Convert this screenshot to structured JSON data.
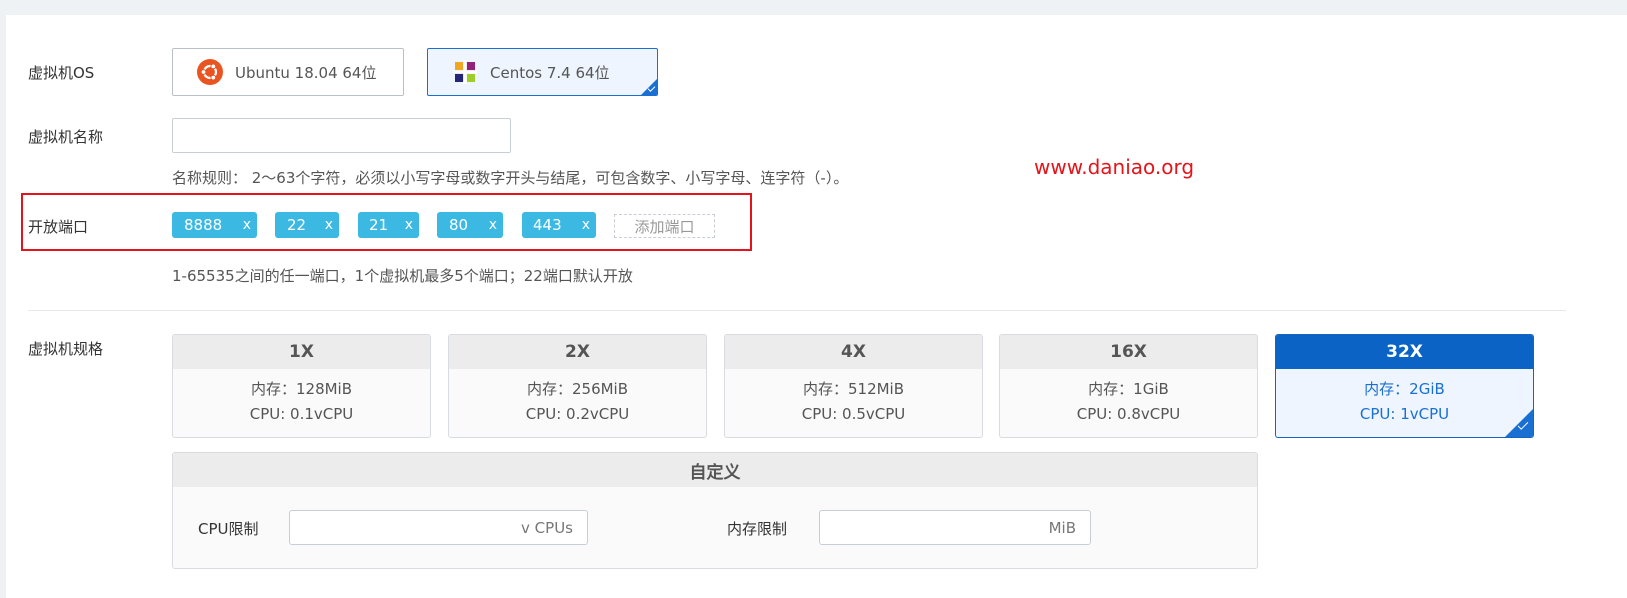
{
  "form": {
    "os": {
      "label": "虚拟机OS",
      "options": [
        {
          "name": "Ubuntu 18.04 64位",
          "selected": false,
          "icon": "ubuntu-logo-icon"
        },
        {
          "name": "Centos 7.4 64位",
          "selected": true,
          "icon": "centos-logo-icon"
        }
      ]
    },
    "vm_name": {
      "label": "虚拟机名称",
      "value": "",
      "placeholder": "",
      "hint": "名称规则： 2～63个字符，必须以小写字母或数字开头与结尾，可包含数字、小写字母、连字符（-）。"
    },
    "ports": {
      "label": "开放端口",
      "tags": [
        "8888",
        "22",
        "21",
        "80",
        "443"
      ],
      "close_glyph": "x",
      "add_label": "添加端口",
      "hint": "1-65535之间的任一端口，1个虚拟机最多5个端口；22端口默认开放"
    },
    "spec": {
      "label": "虚拟机规格",
      "options": [
        {
          "name": "1X",
          "memory": "内存：128MiB",
          "cpu": "CPU: 0.1vCPU",
          "selected": false
        },
        {
          "name": "2X",
          "memory": "内存：256MiB",
          "cpu": "CPU: 0.2vCPU",
          "selected": false
        },
        {
          "name": "4X",
          "memory": "内存：512MiB",
          "cpu": "CPU: 0.5vCPU",
          "selected": false
        },
        {
          "name": "16X",
          "memory": "内存：1GiB",
          "cpu": "CPU: 0.8vCPU",
          "selected": false
        },
        {
          "name": "32X",
          "memory": "内存：2GiB",
          "cpu": "CPU: 1vCPU",
          "selected": true
        }
      ],
      "custom": {
        "title": "自定义",
        "cpu_label": "CPU限制",
        "cpu_unit": "v CPUs",
        "cpu_value": "",
        "mem_label": "内存限制",
        "mem_unit": "MiB",
        "mem_value": ""
      }
    }
  },
  "watermark": "www.daniao.org",
  "colors": {
    "accent": "#1a6fd2",
    "tag": "#3bb9e3",
    "highlight": "#e3141c",
    "watermark": "#e5141a"
  }
}
